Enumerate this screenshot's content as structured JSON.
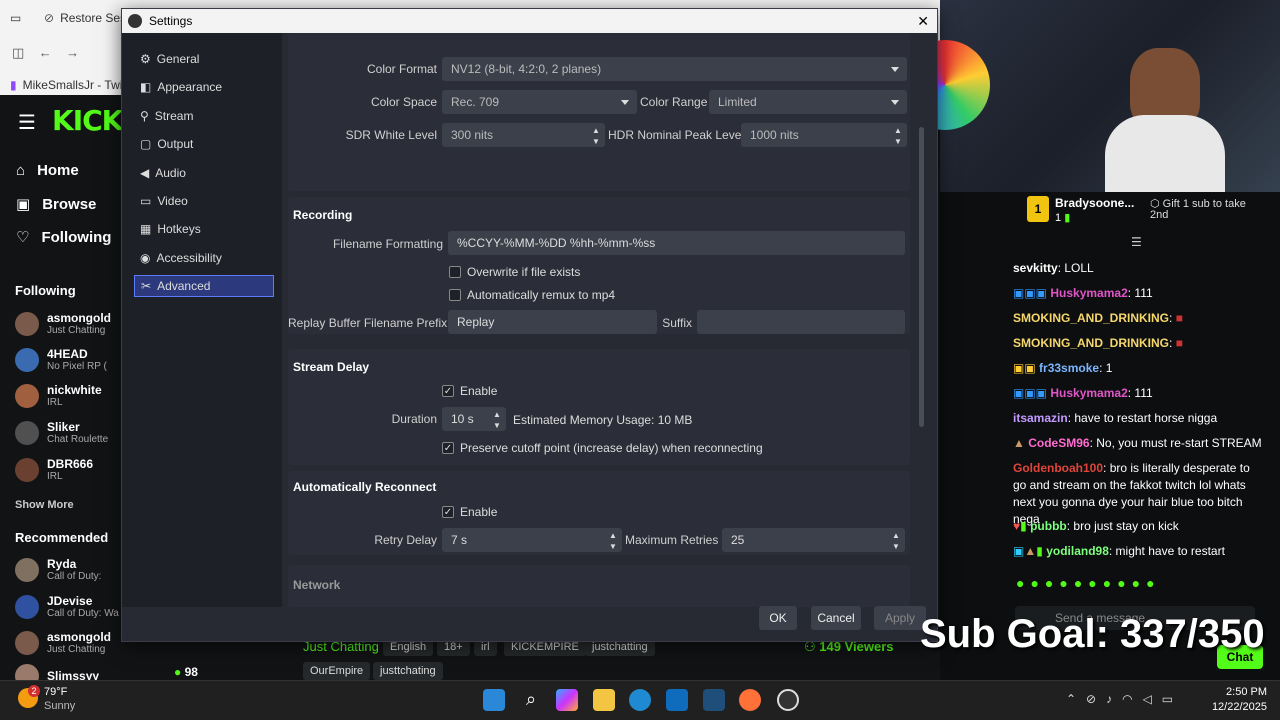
{
  "browser": {
    "tab1": "Restore Session",
    "tab2": "MikeSmallsJr - Twi"
  },
  "kick": {
    "nav": [
      {
        "label": "Home"
      },
      {
        "label": "Browse"
      },
      {
        "label": "Following"
      }
    ],
    "following_title": "Following",
    "following": [
      {
        "name": "asmongold",
        "sub": "Just Chatting",
        "color": "#7a5a4a"
      },
      {
        "name": "4HEAD",
        "sub": "No Pixel RP (",
        "color": "#3a6ab0"
      },
      {
        "name": "nickwhite",
        "sub": "IRL",
        "color": "#a06040"
      },
      {
        "name": "Sliker",
        "sub": "Chat Roulette",
        "color": "#505050"
      },
      {
        "name": "DBR666",
        "sub": "IRL",
        "color": "#6a4030"
      }
    ],
    "show_more": "Show More",
    "recommended_title": "Recommended",
    "recommended": [
      {
        "name": "Ryda",
        "sub": "Call of Duty:",
        "color": "#807060"
      },
      {
        "name": "JDevise",
        "sub": "Call of Duty: Wa",
        "color": "#3050a0"
      },
      {
        "name": "asmongold",
        "sub": "Just Chatting",
        "color": "#7a5a4a"
      },
      {
        "name": "Slimssyy",
        "sub": "",
        "color": "#9a7a6a"
      }
    ],
    "slimssyy_viewers": "98",
    "category": "Just Chatting",
    "tags": [
      "English",
      "18+",
      "irl",
      "KICKEMPIRE",
      "justchatting",
      "OurEmpire",
      "justtchating"
    ],
    "viewers": "149 Viewers"
  },
  "settings": {
    "title": "Settings",
    "sidebar": [
      "General",
      "Appearance",
      "Stream",
      "Output",
      "Audio",
      "Video",
      "Hotkeys",
      "Accessibility",
      "Advanced"
    ],
    "video": {
      "color_format_label": "Color Format",
      "color_format": "NV12 (8-bit, 4:2:0, 2 planes)",
      "color_space_label": "Color Space",
      "color_space": "Rec. 709",
      "color_range_label": "Color Range",
      "color_range": "Limited",
      "sdr_label": "SDR White Level",
      "sdr": "300 nits",
      "hdr_label": "HDR Nominal Peak Level",
      "hdr": "1000 nits"
    },
    "recording": {
      "title": "Recording",
      "filename_label": "Filename Formatting",
      "filename": "%CCYY-%MM-%DD %hh-%mm-%ss",
      "overwrite": "Overwrite if file exists",
      "remux": "Automatically remux to mp4",
      "prefix_label": "Replay Buffer Filename Prefix",
      "prefix": "Replay",
      "suffix_label": "Suffix",
      "suffix": ""
    },
    "stream_delay": {
      "title": "Stream Delay",
      "enable": "Enable",
      "duration_label": "Duration",
      "duration": "10 s",
      "memory": "Estimated Memory Usage: 10 MB",
      "preserve": "Preserve cutoff point (increase delay) when reconnecting"
    },
    "reconnect": {
      "title": "Automatically Reconnect",
      "enable": "Enable",
      "retry_label": "Retry Delay",
      "retry": "7 s",
      "max_label": "Maximum Retries",
      "max": "25"
    },
    "network": {
      "title": "Network"
    },
    "buttons": {
      "ok": "OK",
      "cancel": "Cancel",
      "apply": "Apply"
    }
  },
  "chat": {
    "gifter_name": "Bradysoone...",
    "gifter_count": "1",
    "gift_label": "Gift 1 sub to take 2nd",
    "messages": [
      {
        "user": "sevkitty",
        "text": "LOLL",
        "color": "#ffffff"
      },
      {
        "user": "Huskymama2",
        "text": "111",
        "color": "#e055c8"
      },
      {
        "user": "SMOKING_AND_DRINKING",
        "text": "",
        "color": "#f5d76e"
      },
      {
        "user": "SMOKING_AND_DRINKING",
        "text": "",
        "color": "#f5d76e"
      },
      {
        "user": "fr33smoke",
        "text": "1",
        "color": "#7bb6ff"
      },
      {
        "user": "Huskymama2",
        "text": "111",
        "color": "#e055c8"
      },
      {
        "user": "itsamazin",
        "text": "have to restart horse nigga",
        "color": "#c39bff"
      },
      {
        "user": "CodeSM96",
        "text": "No, you must re-start STREAM",
        "color": "#ff6bd0"
      },
      {
        "user": "Goldenboah100",
        "text": "bro is literally desperate to go and stream on the fakkot twitch lol whats next you gonna dye your hair blue too bitch nega",
        "color": "#e0453a"
      },
      {
        "user": "pubbb",
        "text": "bro just stay on kick",
        "color": "#7dff7d"
      },
      {
        "user": "yodiland98",
        "text": "might have to restart",
        "color": "#7dff7d"
      }
    ],
    "placeholder": "Send a message",
    "chat_button": "Chat"
  },
  "overlay": {
    "sub_goal": "Sub Goal: 337/350"
  },
  "taskbar": {
    "temp": "79°F",
    "weather": "Sunny",
    "badge": "2",
    "time": "2:50 PM",
    "date": "12/22/2025"
  }
}
